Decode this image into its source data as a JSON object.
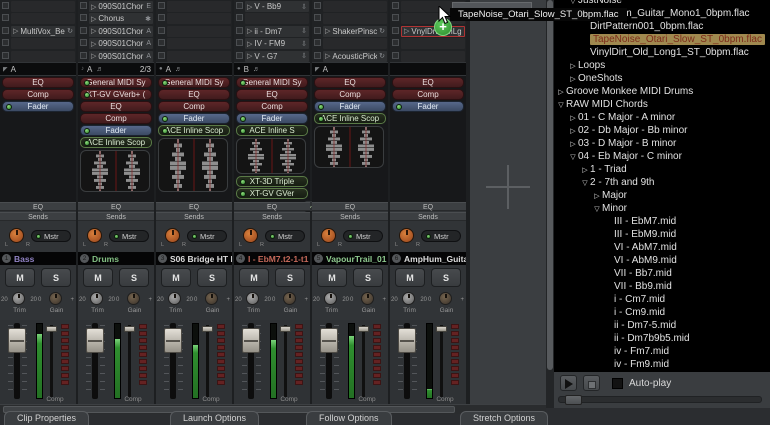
{
  "drag": {
    "tooltip": "TapeNoise_Otari_Slow_ST_0bpm.flac",
    "plus": "+"
  },
  "colors": {
    "plugin_red": "#5e2628",
    "plugin_blue": "#56688a",
    "plugin_green": "#5a7a46",
    "led_green": "#5cb85c",
    "knob_orange": "#d9803c",
    "meter_green": "#3fae3f",
    "comp_red": "#652222",
    "selected_row_bg": "#a0894f",
    "selected_row_text": "#7d2b1a"
  },
  "mixer": {
    "strips": [
      {
        "scene": {
          "icon": "corner",
          "letter": "A",
          "notes": false,
          "quant": ""
        },
        "clips": [
          {
            "name": "",
            "icon": ""
          },
          {
            "name": "",
            "icon": ""
          },
          {
            "name": "MultiVox_Be",
            "icon": "loop"
          },
          {
            "name": "",
            "icon": ""
          },
          {
            "name": "",
            "icon": ""
          }
        ],
        "plugins": [
          {
            "label": "EQ",
            "kind": "red",
            "led": false
          },
          {
            "label": "Comp",
            "kind": "red",
            "led": false
          },
          {
            "label": "Fader",
            "kind": "blue",
            "led": true
          }
        ],
        "scope": 0,
        "post": [],
        "overflow": false,
        "eq": "EQ",
        "sends": "Sends",
        "mstr": "Mstr",
        "num": "1",
        "name": "Bass",
        "name_color": "#9183c4",
        "mute": "M",
        "solo": "S",
        "trim_label": "Trim",
        "trim_min": "20",
        "trim_max": "20",
        "gain_label": "Gain",
        "gain_min": "0",
        "gain_max": "+",
        "comp": "Comp",
        "level": 0.86
      },
      {
        "scene": {
          "icon": "note",
          "letter": "A",
          "notes": true,
          "quant": "2/3"
        },
        "clips": [
          {
            "name": "090S01Chor",
            "icon": "E"
          },
          {
            "name": "Chorus",
            "icon": "gear"
          },
          {
            "name": "090S01Chor",
            "icon": "A"
          },
          {
            "name": "090S01Chor",
            "icon": "A"
          },
          {
            "name": "090S01Chor",
            "icon": "A"
          }
        ],
        "plugins": [
          {
            "label": "General MIDI Sy",
            "kind": "red",
            "led": true
          },
          {
            "label": "XT-GV GVerb+ (",
            "kind": "red",
            "led": true
          },
          {
            "label": "EQ",
            "kind": "red",
            "led": false
          },
          {
            "label": "Comp",
            "kind": "red",
            "led": false
          },
          {
            "label": "Fader",
            "kind": "blue",
            "led": true
          },
          {
            "label": "ACE Inline Scop",
            "kind": "green",
            "led": true
          }
        ],
        "scope": 42,
        "post": [],
        "overflow": false,
        "eq": "EQ",
        "sends": "Sends",
        "mstr": "Mstr",
        "num": "2",
        "name": "Drums",
        "name_color": "#83c083",
        "mute": "M",
        "solo": "S",
        "trim_label": "Trim",
        "trim_min": "20",
        "trim_max": "20",
        "gain_label": "Gain",
        "gain_min": "0",
        "gain_max": "+",
        "comp": "Comp",
        "level": 0.8
      },
      {
        "scene": {
          "icon": "dot",
          "letter": "A",
          "notes": true,
          "quant": ""
        },
        "clips": [
          {
            "name": "",
            "icon": ""
          },
          {
            "name": "",
            "icon": ""
          },
          {
            "name": "",
            "icon": ""
          },
          {
            "name": "",
            "icon": ""
          },
          {
            "name": "",
            "icon": ""
          }
        ],
        "plugins": [
          {
            "label": "General MIDI Sy",
            "kind": "red",
            "led": true
          },
          {
            "label": "EQ",
            "kind": "red",
            "led": false
          },
          {
            "label": "Comp",
            "kind": "red",
            "led": false
          },
          {
            "label": "Fader",
            "kind": "blue",
            "led": true
          },
          {
            "label": "ACE Inline Scop",
            "kind": "green",
            "led": true
          }
        ],
        "scope": 54,
        "post": [],
        "overflow": false,
        "eq": "EQ",
        "sends": "Sends",
        "mstr": "Mstr",
        "num": "3",
        "name": "S06 Bridge HT F",
        "name_color": "#dcdcdc",
        "mute": "M",
        "solo": "S",
        "trim_label": "Trim",
        "trim_min": "20",
        "trim_max": "20",
        "gain_label": "Gain",
        "gain_min": "0",
        "gain_max": "+",
        "comp": "Comp",
        "level": 0.72
      },
      {
        "scene": {
          "icon": "dot",
          "letter": "B",
          "notes": true,
          "quant": ""
        },
        "clips": [
          {
            "name": "V - Bb9",
            "icon": "midi"
          },
          {
            "name": "",
            "icon": ""
          },
          {
            "name": "ii - Dm7",
            "icon": "midi"
          },
          {
            "name": "IV - FM9",
            "icon": "midi"
          },
          {
            "name": "V - G7",
            "icon": "midi"
          }
        ],
        "plugins": [
          {
            "label": "General MIDI Sy",
            "kind": "red",
            "led": true
          },
          {
            "label": "EQ",
            "kind": "red",
            "led": false
          },
          {
            "label": "Comp",
            "kind": "red",
            "led": false
          },
          {
            "label": "Fader",
            "kind": "blue",
            "led": true
          },
          {
            "label": "ACE Inline S",
            "kind": "green",
            "led": true
          }
        ],
        "scope": 36,
        "post": [
          {
            "label": "XT-3D Triple",
            "kind": "green",
            "led": true
          },
          {
            "label": "XT-GV GVer",
            "kind": "green",
            "led": true
          }
        ],
        "overflow": true,
        "eq": "EQ",
        "sends": "Sends",
        "mstr": "Mstr",
        "num": "4",
        "name": "I - EbM7.t2-1-t1",
        "name_color": "#c5695a",
        "mute": "M",
        "solo": "S",
        "trim_label": "Trim",
        "trim_min": "20",
        "trim_max": "20",
        "gain_label": "Gain",
        "gain_min": "0",
        "gain_max": "+",
        "comp": "Comp",
        "level": 0.78
      },
      {
        "scene": {
          "icon": "corner",
          "letter": "A",
          "notes": false,
          "quant": ""
        },
        "clips": [
          {
            "name": "",
            "icon": ""
          },
          {
            "name": "",
            "icon": ""
          },
          {
            "name": "ShakerPinsc",
            "icon": "loop"
          },
          {
            "name": "",
            "icon": ""
          },
          {
            "name": "AcousticPick",
            "icon": "loop"
          }
        ],
        "plugins": [
          {
            "label": "EQ",
            "kind": "red",
            "led": false
          },
          {
            "label": "Comp",
            "kind": "red",
            "led": false
          },
          {
            "label": "Fader",
            "kind": "blue",
            "led": true
          },
          {
            "label": "ACE Inline Scop",
            "kind": "green",
            "led": true
          }
        ],
        "scope": 42,
        "post": [],
        "overflow": false,
        "eq": "EQ",
        "sends": "Sends",
        "mstr": "Mstr",
        "num": "5",
        "name": "VapourTrail_01",
        "name_color": "#8fca8f",
        "mute": "M",
        "solo": "S",
        "trim_label": "Trim",
        "trim_min": "20",
        "trim_max": "20",
        "gain_label": "Gain",
        "gain_min": "0",
        "gain_max": "+",
        "comp": "Comp",
        "level": 0.84
      },
      {
        "scene": {
          "icon": "",
          "letter": "",
          "notes": false,
          "quant": ""
        },
        "clips": [
          {
            "name": "",
            "icon": ""
          },
          {
            "name": "",
            "icon": ""
          },
          {
            "name": "VnylDrtDrmLg",
            "icon": "",
            "drop": true
          },
          {
            "name": "",
            "icon": ""
          },
          {
            "name": "",
            "icon": ""
          }
        ],
        "plugins": [
          {
            "label": "EQ",
            "kind": "red",
            "led": false
          },
          {
            "label": "Comp",
            "kind": "red",
            "led": false
          },
          {
            "label": "Fader",
            "kind": "blue",
            "led": true
          }
        ],
        "scope": 0,
        "post": [],
        "overflow": false,
        "eq": "EQ",
        "sends": "Sends",
        "mstr": "Mstr",
        "num": "6",
        "name": "AmpHum_Guita",
        "name_color": "#dcdcdc",
        "mute": "M",
        "solo": "S",
        "trim_label": "Trim",
        "trim_min": "20",
        "trim_max": "20",
        "gain_label": "Gain",
        "gain_min": "0",
        "gain_max": "+",
        "comp": "Comp",
        "level": 0.12
      }
    ]
  },
  "browser": {
    "rows": [
      {
        "label": "JustNoise",
        "arrow": "down",
        "indent": 1,
        "cut": true
      },
      {
        "label": "AmpHum_Guitar_Mono1_0bpm.flac",
        "arrow": "none",
        "indent": 2
      },
      {
        "label": "DirtPattern001_0bpm.flac",
        "arrow": "none",
        "indent": 2
      },
      {
        "label": "TapeNoise_Otari_Slow_ST_0bpm.flac",
        "arrow": "none",
        "indent": 2,
        "selected": true
      },
      {
        "label": "VinylDirt_Old_Long1_ST_0bpm.flac",
        "arrow": "none",
        "indent": 2
      },
      {
        "label": "Loops",
        "arrow": "right",
        "indent": 1
      },
      {
        "label": "OneShots",
        "arrow": "right",
        "indent": 1
      },
      {
        "label": "Groove Monkee MIDI Drums",
        "arrow": "right",
        "indent": 0
      },
      {
        "label": "RAW MIDI Chords",
        "arrow": "down",
        "indent": 0
      },
      {
        "label": "01 - C Major - A minor",
        "arrow": "right",
        "indent": 1
      },
      {
        "label": "02 - Db Major - Bb minor",
        "arrow": "right",
        "indent": 1
      },
      {
        "label": "03 - D Major - B minor",
        "arrow": "right",
        "indent": 1
      },
      {
        "label": "04 - Eb Major - C minor",
        "arrow": "down",
        "indent": 1
      },
      {
        "label": "1 - Triad",
        "arrow": "right",
        "indent": 2
      },
      {
        "label": "2 - 7th and 9th",
        "arrow": "down",
        "indent": 2
      },
      {
        "label": "Major",
        "arrow": "right",
        "indent": 3
      },
      {
        "label": "Minor",
        "arrow": "down",
        "indent": 3
      },
      {
        "label": "III - EbM7.mid",
        "arrow": "none",
        "indent": 4
      },
      {
        "label": "III - EbM9.mid",
        "arrow": "none",
        "indent": 4
      },
      {
        "label": "VI - AbM7.mid",
        "arrow": "none",
        "indent": 4
      },
      {
        "label": "VI - AbM9.mid",
        "arrow": "none",
        "indent": 4
      },
      {
        "label": "VII - Bb7.mid",
        "arrow": "none",
        "indent": 4
      },
      {
        "label": "VII - Bb9.mid",
        "arrow": "none",
        "indent": 4
      },
      {
        "label": "i - Cm7.mid",
        "arrow": "none",
        "indent": 4
      },
      {
        "label": "i - Cm9.mid",
        "arrow": "none",
        "indent": 4
      },
      {
        "label": "ii - Dm7-5.mid",
        "arrow": "none",
        "indent": 4
      },
      {
        "label": "ii - Dm7b9b5.mid",
        "arrow": "none",
        "indent": 4
      },
      {
        "label": "iv - Fm7.mid",
        "arrow": "none",
        "indent": 4
      },
      {
        "label": "iv - Fm9.mid",
        "arrow": "none",
        "indent": 4
      }
    ],
    "autoplay": "Auto-play"
  },
  "tabs": [
    "Clip Properties",
    "Launch Options",
    "Follow Options",
    "Stretch Options"
  ]
}
